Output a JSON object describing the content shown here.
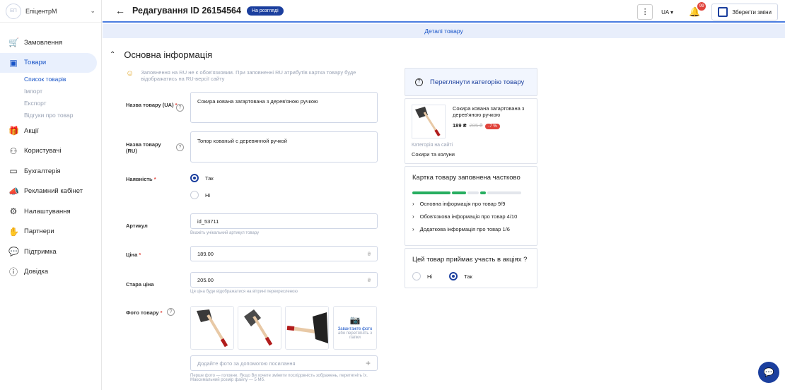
{
  "brand": {
    "logo_text": "ЕП",
    "name": "ЕпіцентрМ"
  },
  "sidebar": {
    "items": [
      {
        "label": "Замовлення",
        "icon": "cart-icon"
      },
      {
        "label": "Товари",
        "icon": "box-icon"
      },
      {
        "label": "Акції",
        "icon": "gift-icon"
      },
      {
        "label": "Користувачі",
        "icon": "users-icon"
      },
      {
        "label": "Бухгалтерія",
        "icon": "wallet-icon"
      },
      {
        "label": "Рекламний кабінет",
        "icon": "megaphone-icon"
      },
      {
        "label": "Налаштування",
        "icon": "gear-icon"
      },
      {
        "label": "Партнери",
        "icon": "handshake-icon"
      },
      {
        "label": "Підтримка",
        "icon": "chat-icon"
      },
      {
        "label": "Довідка",
        "icon": "question-icon"
      }
    ],
    "subitems": [
      "Список товарів",
      "Імпорт",
      "Експорт",
      "Відгуки про товар"
    ]
  },
  "header": {
    "title": "Редагування ID 26154564",
    "status": "На розгляді",
    "lang": "UA",
    "notifications": "99",
    "save_label": "Зберегти зміни"
  },
  "subheader": "Деталі товару",
  "section": {
    "title": "Основна інформація",
    "hint": "Заповнення на RU не є обов'язковим. При заповненні RU атрибутів картка товару буде відображатись на RU-версії сайту"
  },
  "form": {
    "name_ua_label": "Назва товару (UA)",
    "name_ua": "Сокира кована загартована з дерев'яною ручкою",
    "name_ru_label": "Назва товару (RU)",
    "name_ru": "Топор кованый с деревянной ручкой",
    "availability_label": "Наявність",
    "availability_yes": "Так",
    "availability_no": "Ні",
    "sku_label": "Артикул",
    "sku": "id_53711",
    "sku_helper": "Вкажіть унікальний артикул товару",
    "price_label": "Ціна",
    "price": "189.00",
    "currency": "₴",
    "old_price_label": "Стара ціна",
    "old_price": "205.00",
    "old_price_helper": "Ця ціна буде відображатися на вітрині перекресленою",
    "photos_label": "Фото товару",
    "upload_title": "Завантажте фото",
    "upload_sub": "або перетягніть з папки",
    "url_placeholder": "Додайте фото за допомогою посилання",
    "photos_helper": "Перше фото — головне. Якщо Ви хочете змінити послідовність зображень, перетягніть їх. Максимальний розмір файлу — 5 Мб."
  },
  "right": {
    "category_button": "Переглянути категорію товару",
    "product_name": "Сокира кована загартована з дерев'яною ручкою",
    "product_price": "189 ₴",
    "product_old_price": "205 ₴",
    "product_discount": "-7 %",
    "category_label": "Категорія на сайті",
    "category": "Сокири та колуни",
    "fill_title": "Картка товару заповнена частково",
    "fill_items": [
      "Основна інформація про товар 9/9",
      "Обов'язкова інформація про товар 4/10",
      "Додаткова інформація про товар 1/6"
    ],
    "promo_title": "Цей товар приймає участь в акціях ?",
    "promo_no": "Ні",
    "promo_yes": "Так"
  },
  "colors": {
    "accent": "#1b3f9e",
    "link": "#1753c7",
    "progress": "#27ae60",
    "alert": "#e0433b"
  }
}
